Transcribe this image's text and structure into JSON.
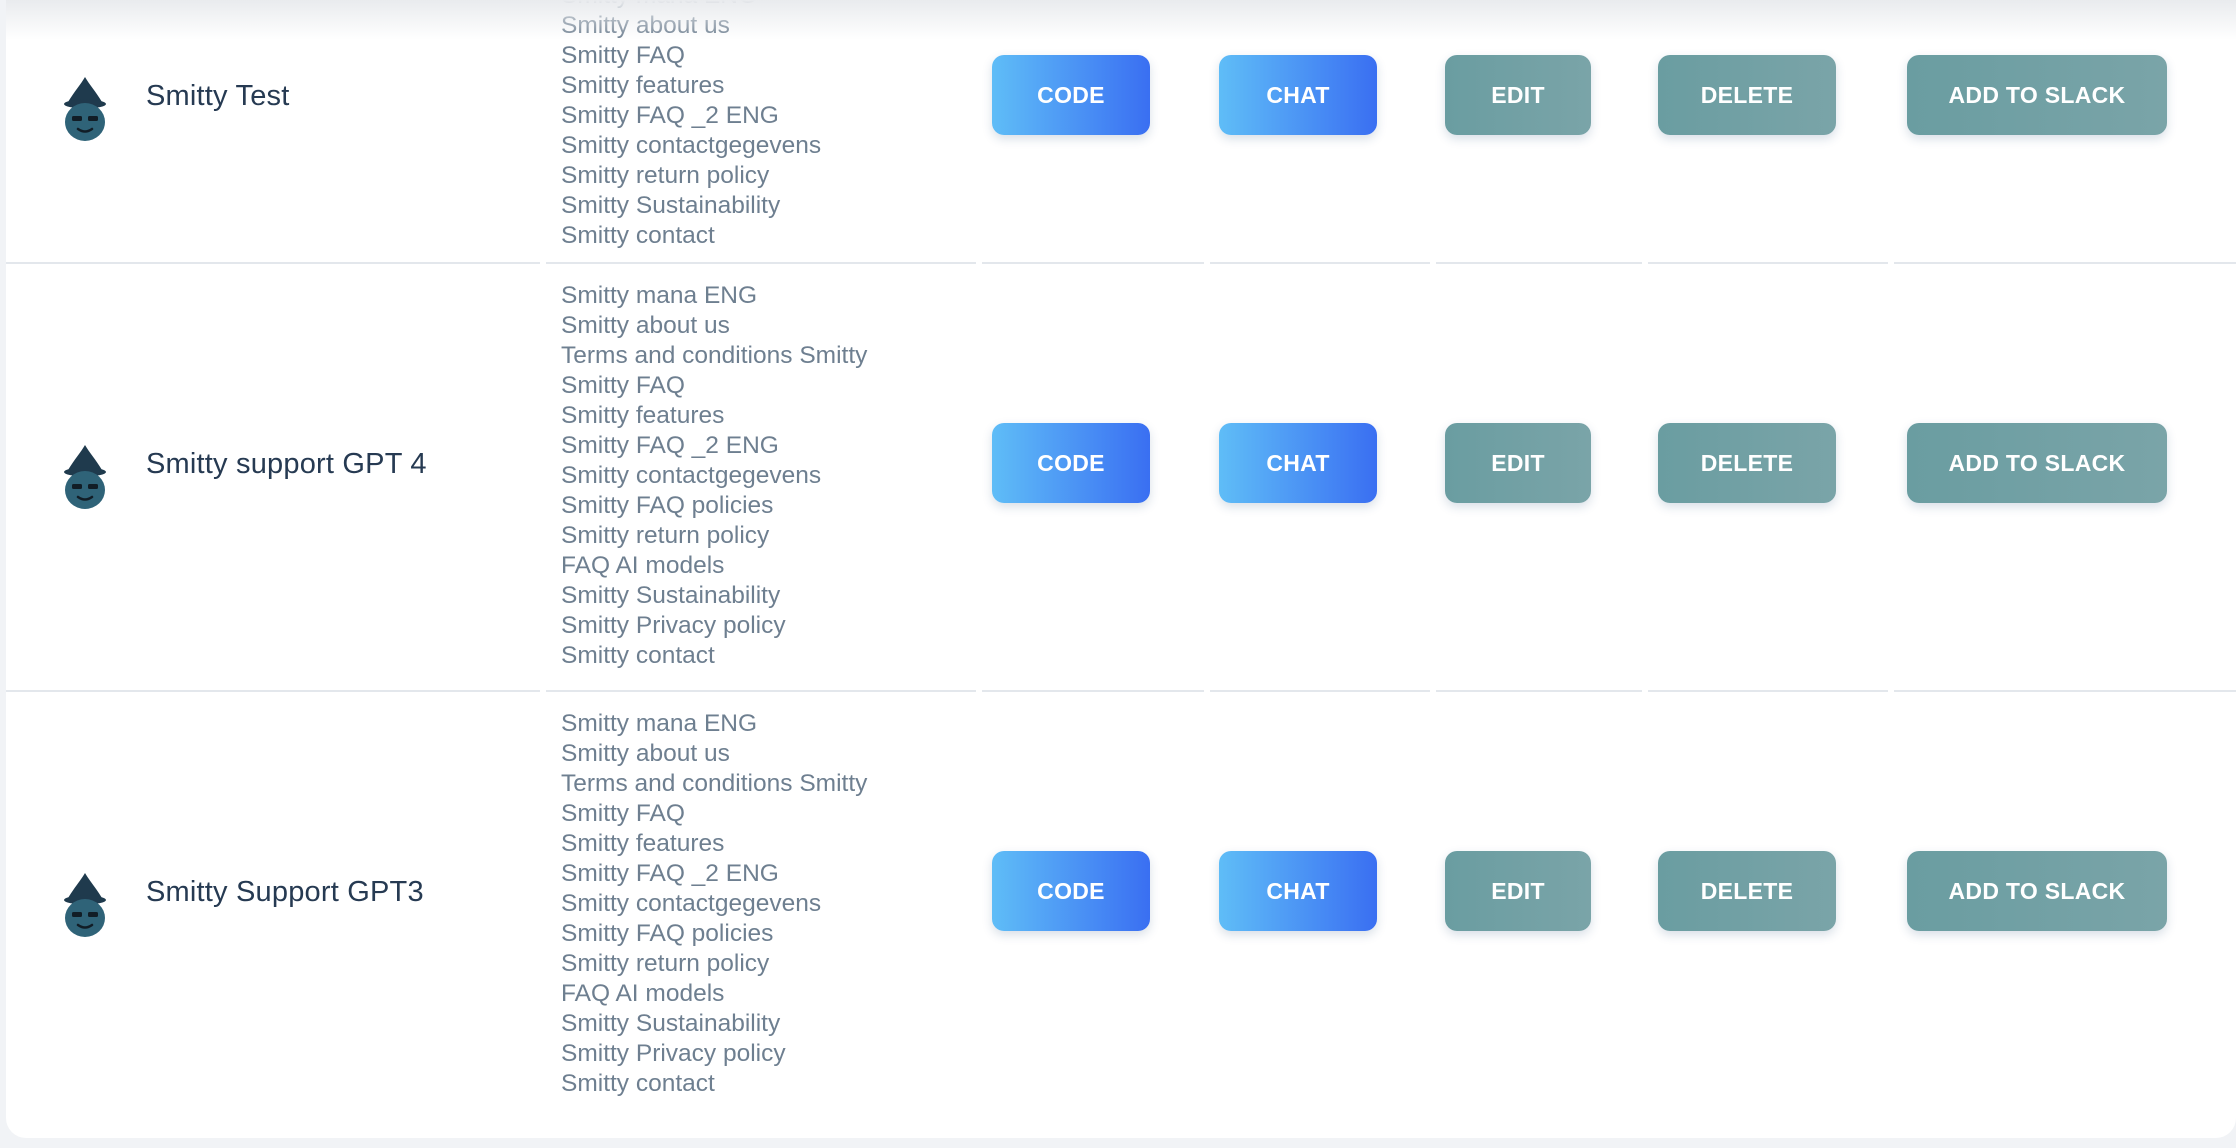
{
  "button_labels": {
    "code": "CODE",
    "chat": "CHAT",
    "edit": "EDIT",
    "delete": "DELETE",
    "add_to_slack": "ADD TO SLACK"
  },
  "colors": {
    "blue_gradient": [
      "#5fbdf7",
      "#3a6ff2"
    ],
    "teal_button": "#6f9fa3",
    "bot_name_text": "#263a52",
    "document_text": "#6e7f90"
  },
  "bots": [
    {
      "name": "Smitty Test",
      "avatar_icon": "wizard-robot-icon",
      "documents": [
        "Smitty mana ENG",
        "Smitty about us",
        "Smitty FAQ",
        "Smitty features",
        "Smitty FAQ _2 ENG",
        "Smitty contactgegevens",
        "Smitty return policy",
        "Smitty Sustainability",
        "Smitty contact"
      ]
    },
    {
      "name": "Smitty support GPT 4",
      "avatar_icon": "wizard-robot-icon",
      "documents": [
        "Smitty mana ENG",
        "Smitty about us",
        "Terms and conditions Smitty",
        "Smitty FAQ",
        "Smitty features",
        "Smitty FAQ _2 ENG",
        "Smitty contactgegevens",
        "Smitty FAQ policies",
        "Smitty return policy",
        "FAQ AI models",
        "Smitty Sustainability",
        "Smitty Privacy policy",
        "Smitty contact"
      ]
    },
    {
      "name": "Smitty Support GPT3",
      "avatar_icon": "wizard-robot-icon",
      "documents": [
        "Smitty mana ENG",
        "Smitty about us",
        "Terms and conditions Smitty",
        "Smitty FAQ",
        "Smitty features",
        "Smitty FAQ _2 ENG",
        "Smitty contactgegevens",
        "Smitty FAQ policies",
        "Smitty return policy",
        "FAQ AI models",
        "Smitty Sustainability",
        "Smitty Privacy policy",
        "Smitty contact"
      ]
    }
  ]
}
